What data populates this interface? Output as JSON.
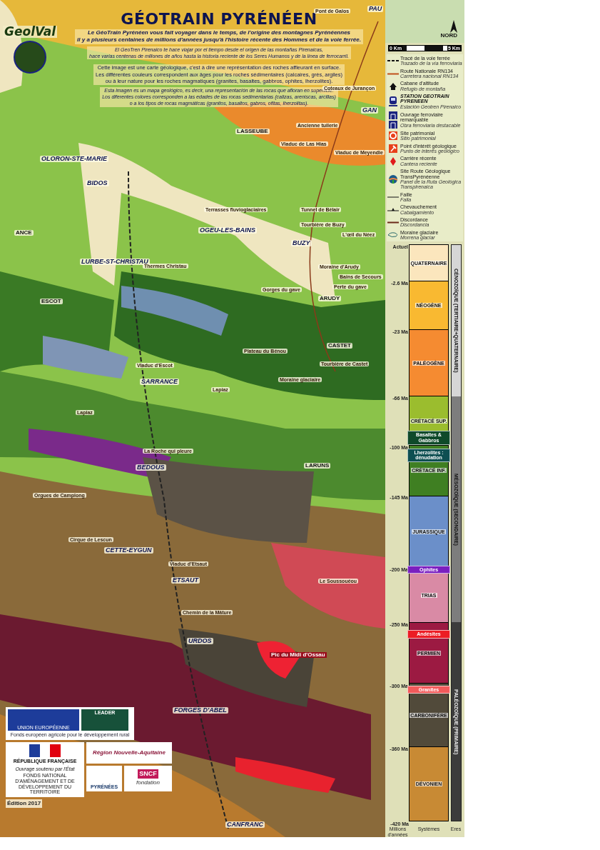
{
  "header": {
    "logo": "GeolVal",
    "title": "GÉOTRAIN PYRÉNÉEN",
    "paragraphs": [
      {
        "kind": "lead",
        "lines": [
          "Le GéoTrain Pyrénéen vous fait voyager dans le temps, de l'origine des montagnes Pyrénéennes",
          "il y a plusieurs centaines de millions d'années jusqu'à l'histoire récente des Hommes et de la voie ferrée."
        ]
      },
      {
        "kind": "lead_translation",
        "lines": [
          "El GeoTren Pirenaico te hace viajar por el tiempo desde el origen de las montañas Pirenaicas,",
          "hace varias centenas de millones de años hasta la historia reciente de los Seres Humanos y de la línea de ferrocarril."
        ]
      },
      {
        "kind": "body",
        "lines": [
          "Cette image est une carte géologique, c'est à dire une représentation des roches affleurant en surface.",
          "Les différentes couleurs correspondent aux âges pour les roches sédimentaires (calcaires, grès, argiles)",
          "ou à leur nature pour les roches magmatiques (granites, basaltes, gabbros, ophites, lherzolites)."
        ]
      },
      {
        "kind": "body_translation",
        "lines": [
          "Esta imagen es un mapa geológico, es decir, una representación de las rocas que afloran en superficie.",
          "Los diferentes colores corresponden a las edades de las rocas sedimentarias (calizas, areniscas, arcillas)",
          "o a los tipos de rocas magmáticas (granitos, basaltos, gabros, ofitas, lherzolitas)."
        ]
      }
    ]
  },
  "map_labels": [
    {
      "text": "Pont de Galos",
      "kind": "site"
    },
    {
      "text": "PAU",
      "kind": "station"
    },
    {
      "text": "Coteaux de Jurançon",
      "kind": "site"
    },
    {
      "text": "GAN",
      "kind": "station"
    },
    {
      "text": "Ancienne tuilerie",
      "kind": "site"
    },
    {
      "text": "LASSEUBE",
      "kind": "town"
    },
    {
      "text": "Viaduc de Las Hias",
      "kind": "site"
    },
    {
      "text": "Viaduc de Meyendie",
      "kind": "site"
    },
    {
      "text": "OLORON-STE-MARIE",
      "kind": "station"
    },
    {
      "text": "BIDOS",
      "kind": "station"
    },
    {
      "text": "Terrasses fluvioglaciaires",
      "kind": "site"
    },
    {
      "text": "Tunnel de Bélair",
      "kind": "site"
    },
    {
      "text": "Tourbière de Buzy",
      "kind": "site"
    },
    {
      "text": "OGEU-LES-BAINS",
      "kind": "station"
    },
    {
      "text": "BUZY",
      "kind": "station"
    },
    {
      "text": "L'œil du Néez",
      "kind": "site"
    },
    {
      "text": "ANCE",
      "kind": "town"
    },
    {
      "text": "LURBE-ST-CHRISTAU",
      "kind": "station"
    },
    {
      "text": "Thermes Christau",
      "kind": "site"
    },
    {
      "text": "Moraine d'Arudy",
      "kind": "site"
    },
    {
      "text": "Bains de Secours",
      "kind": "site"
    },
    {
      "text": "Gorges du gave",
      "kind": "site"
    },
    {
      "text": "Perte du gave",
      "kind": "site"
    },
    {
      "text": "ARUDY",
      "kind": "town"
    },
    {
      "text": "ESCOT",
      "kind": "town"
    },
    {
      "text": "Viaduc d'Escot",
      "kind": "site"
    },
    {
      "text": "SARRANCE",
      "kind": "station"
    },
    {
      "text": "Plateau du Bénou",
      "kind": "site"
    },
    {
      "text": "CASTET",
      "kind": "town"
    },
    {
      "text": "Tourbière de Castet",
      "kind": "site"
    },
    {
      "text": "Moraine glaciaire",
      "kind": "site"
    },
    {
      "text": "Lapiaz",
      "kind": "site"
    },
    {
      "text": "Lapiaz",
      "kind": "site"
    },
    {
      "text": "La Roche qui pleure",
      "kind": "site"
    },
    {
      "text": "BEDOUS",
      "kind": "station"
    },
    {
      "text": "LARUNS",
      "kind": "town"
    },
    {
      "text": "Orgues de Camplong",
      "kind": "site"
    },
    {
      "text": "Cirque de Lescun",
      "kind": "site"
    },
    {
      "text": "CETTE-EYGUN",
      "kind": "station"
    },
    {
      "text": "Viaduc d'Etsaut",
      "kind": "site"
    },
    {
      "text": "ETSAUT",
      "kind": "station"
    },
    {
      "text": "Le Soussouéou",
      "kind": "site"
    },
    {
      "text": "Chemin de la Mâture",
      "kind": "site"
    },
    {
      "text": "URDOS",
      "kind": "station"
    },
    {
      "text": "Pic du Midi d'Ossau",
      "kind": "peak"
    },
    {
      "text": "FORGES D'ABEL",
      "kind": "station"
    },
    {
      "text": "CANFRANC",
      "kind": "station"
    }
  ],
  "logos": {
    "eu": "UNION EUROPÉENNE",
    "leader": "LEADER",
    "eu_note": "Fonds européen agricole pour le développement rural",
    "republic": "RÉPUBLIQUE FRANÇAISE",
    "region": "Région Nouvelle-Aquitaine",
    "state_note": "Ouvrage soutenu par l'État",
    "state_fund": "FONDS NATIONAL D'AMÉNAGEMENT ET DE DÉVELOPPEMENT DU TERRITOIRE",
    "pyrenees": "PYRÉNÉES",
    "sncf": "SNCF",
    "sncf_sub": "fondation"
  },
  "edition": "Édition 2017",
  "compass": {
    "label": "NORD"
  },
  "scale": {
    "start": "0 Km",
    "end": "5 Km"
  },
  "legend": [
    {
      "kind": "rail",
      "fr": "Tracé de la voie ferrée",
      "es": "Trazado de la vía ferroviaria"
    },
    {
      "kind": "road",
      "fr": "Route Nationale RN134",
      "es": "Carretera nacional RN134"
    },
    {
      "kind": "hut",
      "fr": "Cabane d'altitude",
      "es": "Refugio de montaña"
    },
    {
      "kind": "station",
      "fr": "STATION GEOTRAIN PYRENEEN",
      "es": "Estación Geotren Pirenaico"
    },
    {
      "kind": "bridge",
      "fr": "Ouvrage ferroviaire remarquable",
      "es": "Obra ferroviaria destacable"
    },
    {
      "kind": "heritage",
      "fr": "Site patrimonial",
      "es": "Sitio patrimonial"
    },
    {
      "kind": "geology",
      "fr": "Point d'intérêt géologique",
      "es": "Punto de interés geológico"
    },
    {
      "kind": "quarry",
      "fr": "Carrière récente",
      "es": "Cantera reciente"
    },
    {
      "kind": "route",
      "fr": "Site Route Géologique TransPyrénéenne",
      "es": "Panel de la Ruta Geológica Transpirenaica"
    },
    {
      "kind": "fault",
      "fr": "Faille",
      "es": "Falla"
    },
    {
      "kind": "thrust",
      "fr": "Chevauchement",
      "es": "Cabalgamiento"
    },
    {
      "kind": "unconformity",
      "fr": "Discordance",
      "es": "Discordancia"
    },
    {
      "kind": "moraine",
      "fr": "Moraine glaciaire",
      "es": "Morrena glaciar"
    }
  ],
  "timescale": {
    "systems": [
      {
        "name": "QUATERNAIRE",
        "age": "Actuel",
        "color": "#fbe6bd"
      },
      {
        "name": "NÉOGÈNE",
        "age": "-2.6 Ma",
        "color": "#f9b931"
      },
      {
        "name": "PALÉOGÈNE",
        "age": "-23 Ma",
        "color": "#f58b31"
      },
      {
        "name": "CRÉTACÉ SUP.",
        "age": "-66 Ma",
        "color": "#9bbd2e"
      },
      {
        "name": "CRÉTACÉ INF.",
        "age": "-100 Ma",
        "color": "#3f7f22"
      },
      {
        "name": "JURASSIQUE",
        "age": "-145 Ma",
        "color": "#6b8fc9"
      },
      {
        "name": "TRIAS",
        "age": "-200 Ma",
        "color": "#d98aa5"
      },
      {
        "name": "PERMIEN",
        "age": "-250 Ma",
        "color": "#9c1a42"
      },
      {
        "name": "CARBONIFÈRE",
        "age": "-300 Ma",
        "color": "#514a3a"
      },
      {
        "name": "DÉVONIEN",
        "age": "-360 Ma",
        "color": "#c88a34"
      }
    ],
    "end_age": "-420 Ma",
    "rocks": [
      {
        "name": "Basaltes & Gabbros",
        "color": "#0f4a2a"
      },
      {
        "name": "Lherzolites : dénudation",
        "color": "#0e4f52"
      },
      {
        "name": "Ophites",
        "color": "#7a1fc0"
      },
      {
        "name": "Andésites",
        "color": "#ec1c24"
      },
      {
        "name": "Granites",
        "color": "#f25a5a"
      }
    ],
    "eras": [
      {
        "name": "CÉNOZOÏQUE (TERTIAIRE+QUATERNAIRE)",
        "color": "#d6d6d6"
      },
      {
        "name": "MÉSOZOÏQUE (SECONDAIRE)",
        "color": "#7d7d7d"
      },
      {
        "name": "PALÉOZOÏQUE (PRIMAIRE)",
        "color": "#3c3c3c"
      }
    ],
    "footer": [
      "Millions d'années",
      "Systèmes",
      "Eres"
    ]
  }
}
